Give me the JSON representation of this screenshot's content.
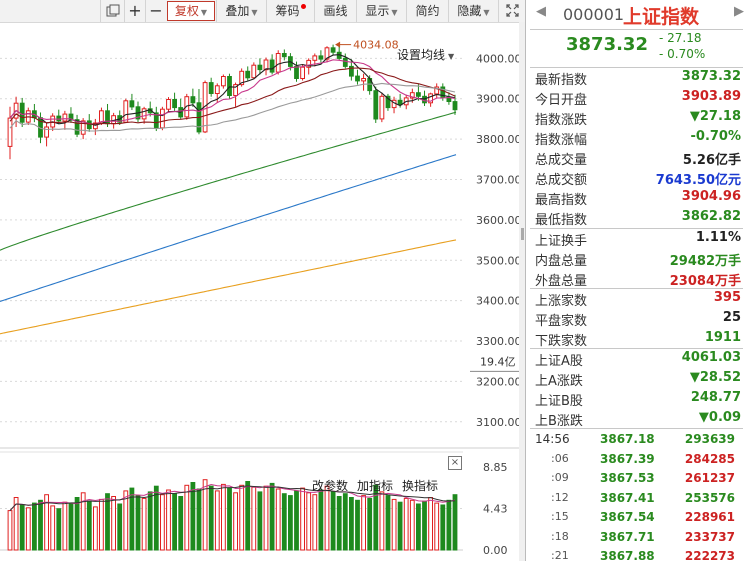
{
  "toolbar": {
    "items": [
      {
        "label": "复权",
        "dropdown": true,
        "active": true
      },
      {
        "label": "叠加",
        "dropdown": true
      },
      {
        "label": "筹码",
        "dot": true
      },
      {
        "label": "画线"
      },
      {
        "label": "显示",
        "dropdown": true
      },
      {
        "label": "简约"
      },
      {
        "label": "隐藏",
        "dropdown": true
      }
    ],
    "icons": [
      "layout-icon",
      "plus-icon",
      "minus-icon",
      "expand-icon"
    ]
  },
  "chart": {
    "setting_label": "设置均线",
    "peak_label": "4034.08",
    "price_axis": [
      "4000.00",
      "3900.00",
      "3800.00",
      "3700.00",
      "3600.00",
      "3500.00",
      "3400.00",
      "3300.00",
      "3200.00",
      "3100.00"
    ],
    "volume_unit": "19.4亿",
    "volume_axis": [
      "8.85",
      "4.43",
      "0.00"
    ],
    "volume_tools": [
      "改参数",
      "加指标",
      "换指标"
    ],
    "colors": {
      "up": "#e02020",
      "down": "#1e8a1e",
      "ma5": "#222222",
      "ma10": "#c8388c",
      "ma20": "#8a1a1a",
      "ma60": "#2e8a2e",
      "ma120": "#2a78c8",
      "ma250": "#e8a020"
    }
  },
  "chart_data": {
    "type": "candlestick",
    "ylim": [
      3050,
      4090
    ],
    "ohlc": [
      [
        3782,
        3880,
        3750,
        3852
      ],
      [
        3852,
        3905,
        3830,
        3889
      ],
      [
        3889,
        3902,
        3830,
        3842
      ],
      [
        3842,
        3878,
        3835,
        3870
      ],
      [
        3870,
        3887,
        3842,
        3853
      ],
      [
        3853,
        3866,
        3790,
        3805
      ],
      [
        3805,
        3840,
        3782,
        3830
      ],
      [
        3830,
        3864,
        3820,
        3857
      ],
      [
        3857,
        3873,
        3838,
        3845
      ],
      [
        3845,
        3870,
        3823,
        3862
      ],
      [
        3862,
        3879,
        3840,
        3848
      ],
      [
        3848,
        3860,
        3805,
        3812
      ],
      [
        3812,
        3852,
        3800,
        3845
      ],
      [
        3845,
        3862,
        3818,
        3826
      ],
      [
        3826,
        3850,
        3810,
        3840
      ],
      [
        3840,
        3878,
        3835,
        3870
      ],
      [
        3870,
        3887,
        3830,
        3838
      ],
      [
        3838,
        3865,
        3826,
        3858
      ],
      [
        3858,
        3871,
        3835,
        3842
      ],
      [
        3842,
        3900,
        3840,
        3895
      ],
      [
        3895,
        3912,
        3872,
        3880
      ],
      [
        3880,
        3893,
        3842,
        3850
      ],
      [
        3850,
        3880,
        3838,
        3875
      ],
      [
        3875,
        3893,
        3856,
        3865
      ],
      [
        3865,
        3880,
        3820,
        3828
      ],
      [
        3828,
        3880,
        3822,
        3874
      ],
      [
        3874,
        3904,
        3866,
        3898
      ],
      [
        3898,
        3915,
        3870,
        3878
      ],
      [
        3878,
        3900,
        3850,
        3855
      ],
      [
        3855,
        3912,
        3848,
        3905
      ],
      [
        3905,
        3925,
        3880,
        3890
      ],
      [
        3890,
        3924,
        3812,
        3818
      ],
      [
        3818,
        3945,
        3815,
        3940
      ],
      [
        3940,
        3952,
        3905,
        3913
      ],
      [
        3913,
        3938,
        3890,
        3932
      ],
      [
        3932,
        3960,
        3925,
        3955
      ],
      [
        3955,
        3962,
        3900,
        3908
      ],
      [
        3908,
        3940,
        3880,
        3935
      ],
      [
        3935,
        3975,
        3930,
        3968
      ],
      [
        3968,
        3980,
        3945,
        3952
      ],
      [
        3952,
        3990,
        3948,
        3983
      ],
      [
        3983,
        4000,
        3960,
        3972
      ],
      [
        3972,
        4002,
        3958,
        3996
      ],
      [
        3996,
        4010,
        3960,
        3966
      ],
      [
        3966,
        4020,
        3960,
        4012
      ],
      [
        4012,
        4022,
        3995,
        4004
      ],
      [
        4004,
        4013,
        3970,
        3980
      ],
      [
        3980,
        3992,
        3942,
        3950
      ],
      [
        3950,
        3985,
        3945,
        3978
      ],
      [
        3978,
        4000,
        3960,
        3995
      ],
      [
        3995,
        4012,
        3980,
        4006
      ],
      [
        4006,
        4020,
        3990,
        3998
      ],
      [
        3998,
        4030,
        3990,
        4026
      ],
      [
        4026,
        4034,
        4008,
        4015
      ],
      [
        4015,
        4030,
        3995,
        4000
      ],
      [
        4000,
        4012,
        3975,
        3980
      ],
      [
        3980,
        3998,
        3945,
        3956
      ],
      [
        3956,
        3972,
        3935,
        3944
      ],
      [
        3944,
        3962,
        3920,
        3950
      ],
      [
        3950,
        3958,
        3910,
        3920
      ],
      [
        3920,
        3930,
        3840,
        3850
      ],
      [
        3850,
        3915,
        3842,
        3906
      ],
      [
        3906,
        3912,
        3870,
        3878
      ],
      [
        3878,
        3905,
        3864,
        3896
      ],
      [
        3896,
        3912,
        3878,
        3885
      ],
      [
        3885,
        3910,
        3874,
        3902
      ],
      [
        3902,
        3925,
        3890,
        3915
      ],
      [
        3915,
        3936,
        3895,
        3906
      ],
      [
        3906,
        3920,
        3882,
        3890
      ],
      [
        3890,
        3915,
        3880,
        3912
      ],
      [
        3912,
        3938,
        3902,
        3929
      ],
      [
        3929,
        3938,
        3895,
        3904
      ],
      [
        3904,
        3916,
        3885,
        3893
      ],
      [
        3893,
        3910,
        3860,
        3873
      ]
    ],
    "volume": [
      4.2,
      5.6,
      4.8,
      4.5,
      5.0,
      5.3,
      5.9,
      4.7,
      4.4,
      5.1,
      4.9,
      5.6,
      6.1,
      5.2,
      4.6,
      5.4,
      6.0,
      5.7,
      4.9,
      6.3,
      6.6,
      5.8,
      5.5,
      6.2,
      6.8,
      5.9,
      6.4,
      6.0,
      5.7,
      6.9,
      7.2,
      6.5,
      7.5,
      6.8,
      6.3,
      7.0,
      6.6,
      6.1,
      6.9,
      7.3,
      6.7,
      6.2,
      6.8,
      7.1,
      6.5,
      6.0,
      5.8,
      6.3,
      6.6,
      6.1,
      5.9,
      6.4,
      6.8,
      6.2,
      5.7,
      6.0,
      5.6,
      5.3,
      5.8,
      5.5,
      6.9,
      6.2,
      5.8,
      5.4,
      5.1,
      5.5,
      5.3,
      4.9,
      5.2,
      5.6,
      5.0,
      4.8,
      5.3,
      5.9
    ],
    "volume_ylim": [
      0,
      8.85
    ]
  },
  "panel": {
    "code": "000001",
    "name": "上证指数",
    "price": "3873.32",
    "change": "- 27.18",
    "change_pct": "- 0.70%",
    "rows1": [
      {
        "label": "最新指数",
        "value": "3873.32",
        "color": "green"
      },
      {
        "label": "今日开盘",
        "value": "3903.89",
        "color": "red"
      },
      {
        "label": "指数涨跌",
        "value": "▼27.18",
        "color": "green"
      },
      {
        "label": "指数涨幅",
        "value": "-0.70%",
        "color": "green"
      },
      {
        "label": "总成交量",
        "value": "5.26亿手",
        "color": "dark"
      },
      {
        "label": "总成交额",
        "value": "7643.50亿元",
        "color": "blue"
      },
      {
        "label": "最高指数",
        "value": "3904.96",
        "color": "red"
      },
      {
        "label": "最低指数",
        "value": "3862.82",
        "color": "green"
      }
    ],
    "rows2": [
      {
        "label": "上证换手",
        "value": "1.11%",
        "color": "dark"
      },
      {
        "label": "内盘总量",
        "value": "29482万手",
        "color": "green"
      },
      {
        "label": "外盘总量",
        "value": "23084万手",
        "color": "red"
      }
    ],
    "rows3": [
      {
        "label": "上涨家数",
        "value": "395",
        "color": "red"
      },
      {
        "label": "平盘家数",
        "value": "25",
        "color": "dark"
      },
      {
        "label": "下跌家数",
        "value": "1911",
        "color": "green"
      }
    ],
    "rows4": [
      {
        "label": "上证A股",
        "value": "4061.03",
        "color": "green"
      },
      {
        "label": "上A涨跌",
        "value": "▼28.52",
        "color": "green"
      },
      {
        "label": "上证B股",
        "value": "248.77",
        "color": "green"
      },
      {
        "label": "上B涨跌",
        "value": "▼0.09",
        "color": "green"
      }
    ],
    "ticks": [
      {
        "time": "14:56",
        "price": "3867.18",
        "vol": "293639",
        "color": "green"
      },
      {
        "time": ":06",
        "price": "3867.39",
        "vol": "284285",
        "color": "red"
      },
      {
        "time": ":09",
        "price": "3867.53",
        "vol": "261237",
        "color": "red"
      },
      {
        "time": ":12",
        "price": "3867.41",
        "vol": "253576",
        "color": "green"
      },
      {
        "time": ":15",
        "price": "3867.54",
        "vol": "228961",
        "color": "red"
      },
      {
        "time": ":18",
        "price": "3867.71",
        "vol": "233737",
        "color": "red"
      },
      {
        "time": ":21",
        "price": "3867.88",
        "vol": "222273",
        "color": "red"
      }
    ]
  }
}
